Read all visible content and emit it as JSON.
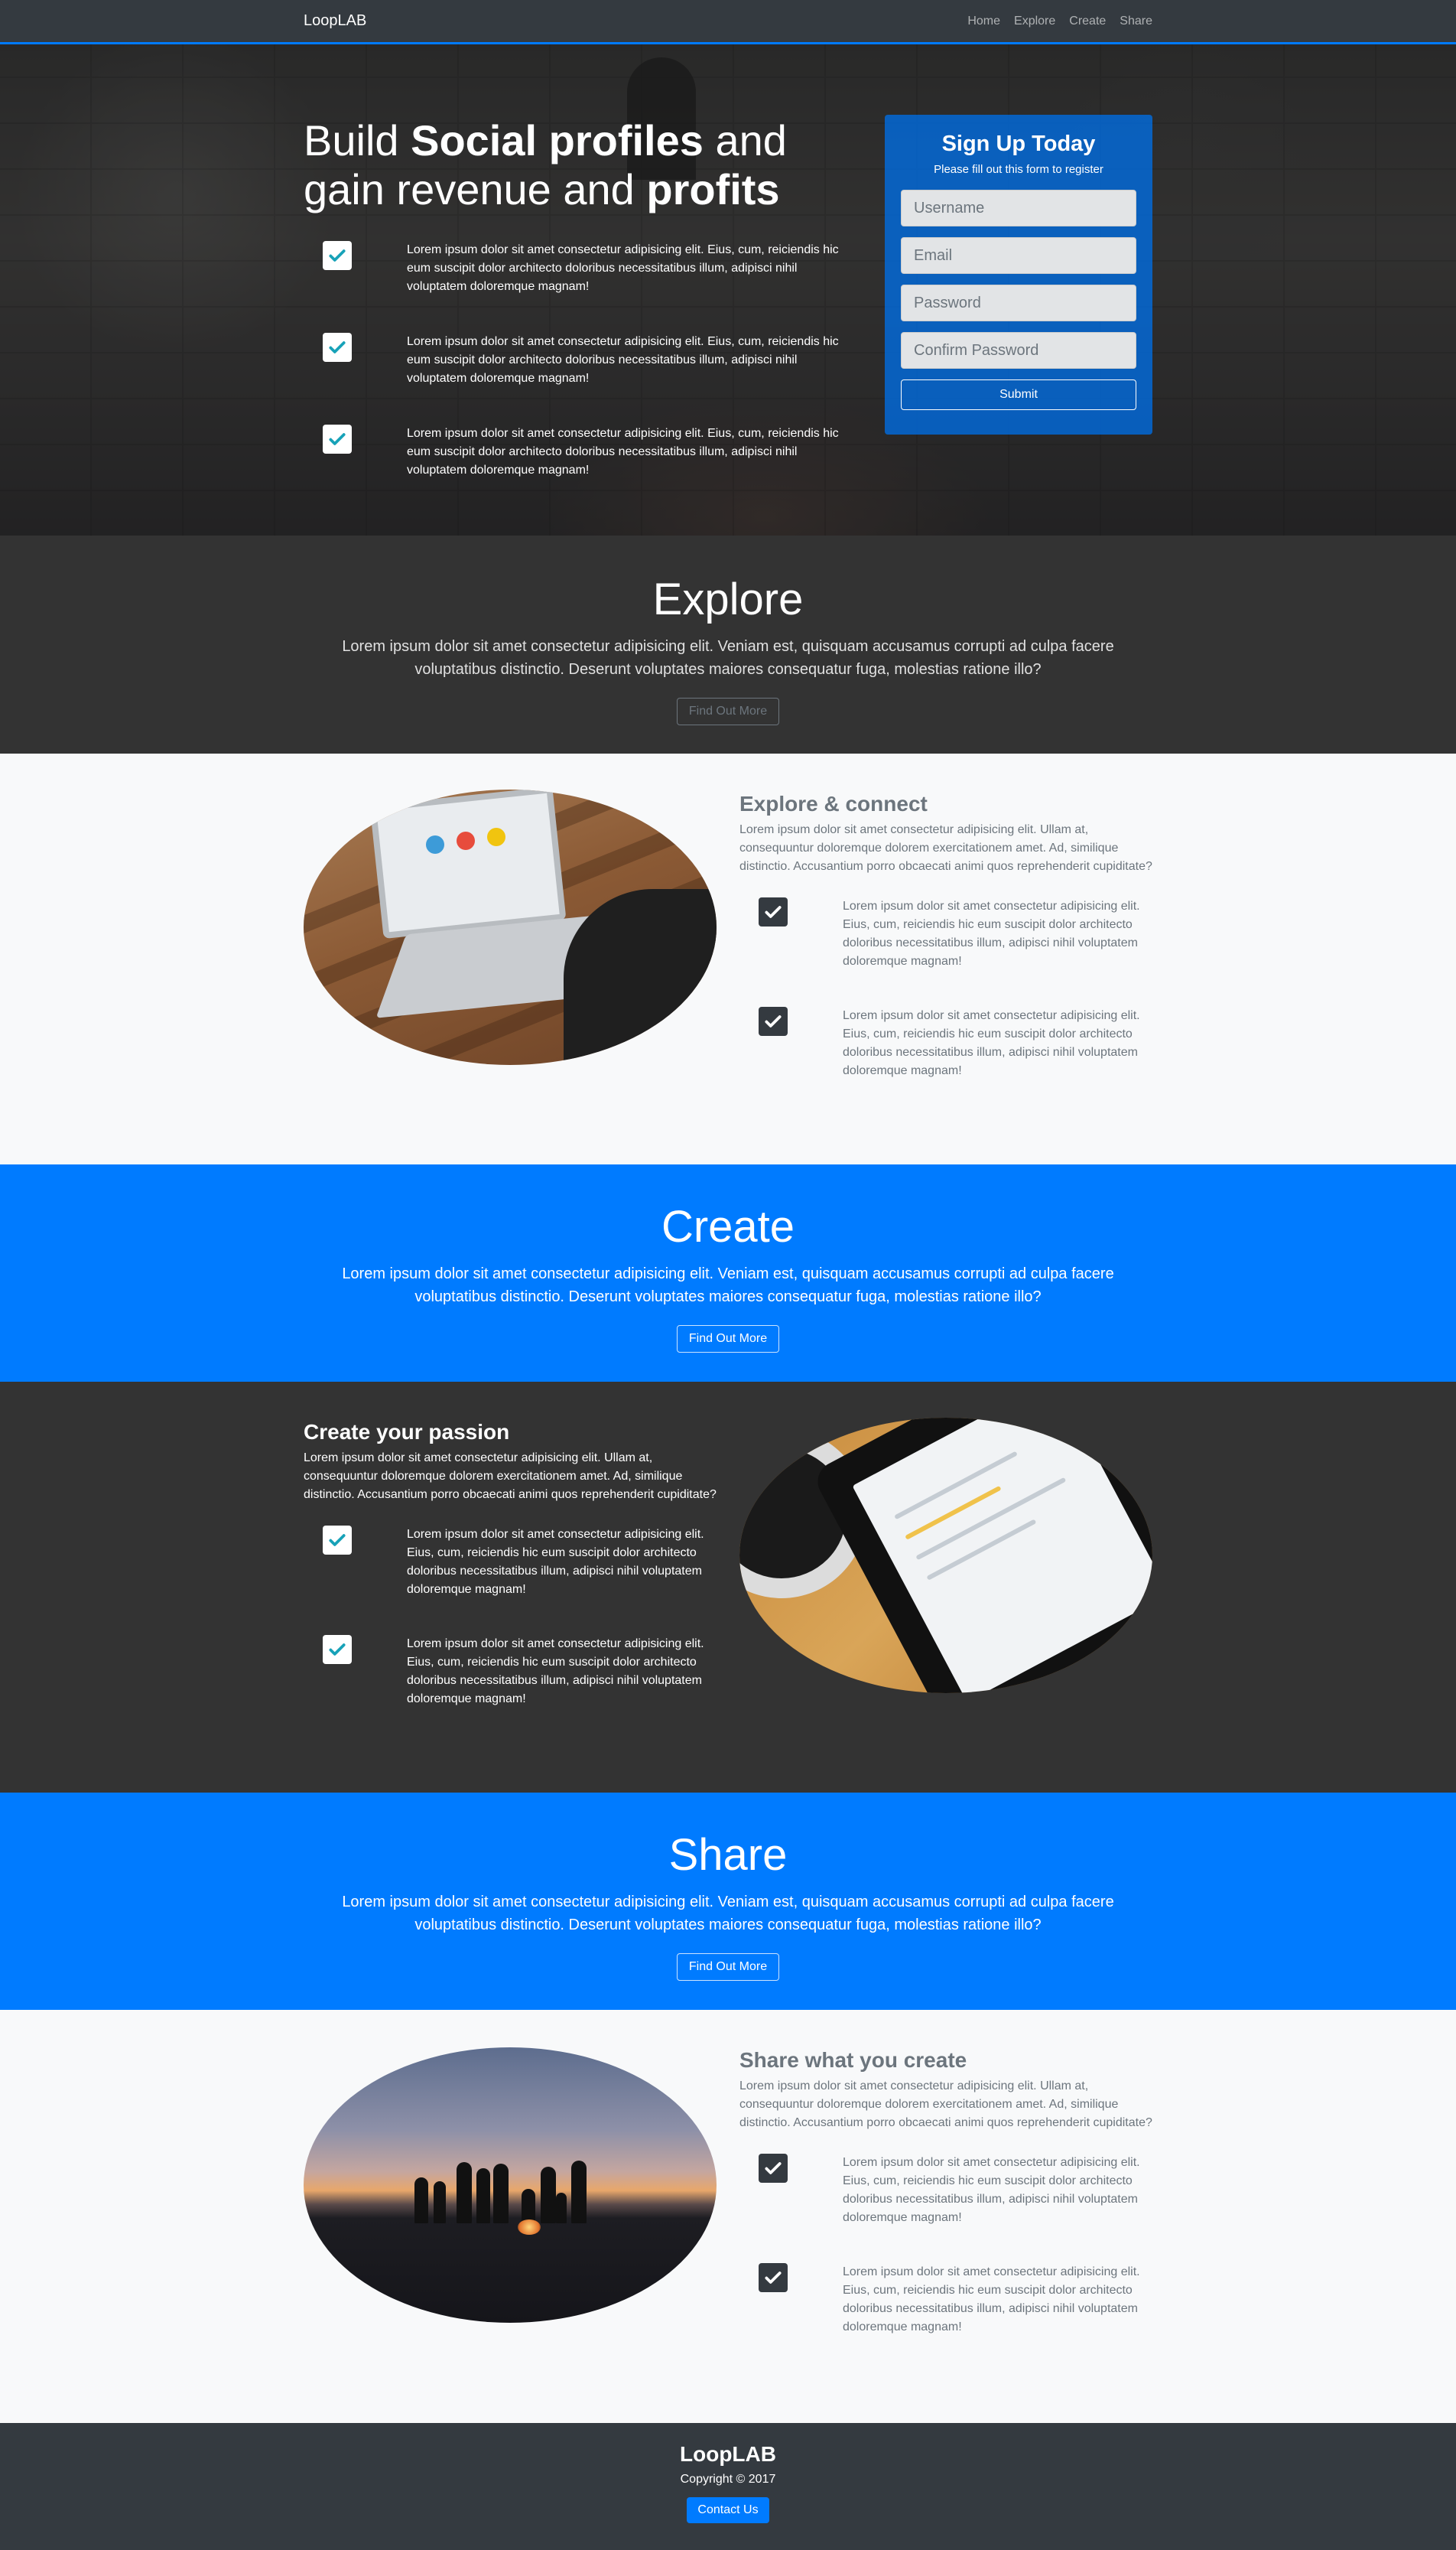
{
  "nav": {
    "brand": "LoopLAB",
    "links": [
      "Home",
      "Explore",
      "Create",
      "Share"
    ]
  },
  "hero": {
    "title_pre": "Build ",
    "title_bold1": "Social profiles",
    "title_mid": " and gain revenue and ",
    "title_bold2": "profits",
    "items": [
      "Lorem ipsum dolor sit amet consectetur adipisicing elit. Eius, cum, reiciendis hic eum suscipit dolor architecto doloribus necessitatibus illum, adipisci nihil voluptatem doloremque magnam!",
      "Lorem ipsum dolor sit amet consectetur adipisicing elit. Eius, cum, reiciendis hic eum suscipit dolor architecto doloribus necessitatibus illum, adipisci nihil voluptatem doloremque magnam!",
      "Lorem ipsum dolor sit amet consectetur adipisicing elit. Eius, cum, reiciendis hic eum suscipit dolor architecto doloribus necessitatibus illum, adipisci nihil voluptatem doloremque magnam!"
    ]
  },
  "signup": {
    "title": "Sign Up Today",
    "subtitle": "Please fill out this form to register",
    "username_placeholder": "Username",
    "email_placeholder": "Email",
    "password_placeholder": "Password",
    "confirm_placeholder": "Confirm Password",
    "submit_label": "Submit"
  },
  "explore": {
    "title": "Explore",
    "desc": "Lorem ipsum dolor sit amet consectetur adipisicing elit. Veniam est, quisquam accusamus corrupti ad culpa facere voluptatibus distinctio. Deserunt voluptates maiores consequatur fuga, molestias ratione illo?",
    "button": "Find Out More"
  },
  "explore_connect": {
    "title": "Explore & connect",
    "intro": "Lorem ipsum dolor sit amet consectetur adipisicing elit. Ullam at, consequuntur doloremque dolorem exercitationem amet. Ad, similique distinctio. Accusantium porro obcaecati animi quos reprehenderit cupiditate?",
    "items": [
      "Lorem ipsum dolor sit amet consectetur adipisicing elit. Eius, cum, reiciendis hic eum suscipit dolor architecto doloribus necessitatibus illum, adipisci nihil voluptatem doloremque magnam!",
      "Lorem ipsum dolor sit amet consectetur adipisicing elit. Eius, cum, reiciendis hic eum suscipit dolor architecto doloribus necessitatibus illum, adipisci nihil voluptatem doloremque magnam!"
    ]
  },
  "create": {
    "title": "Create",
    "desc": "Lorem ipsum dolor sit amet consectetur adipisicing elit. Veniam est, quisquam accusamus corrupti ad culpa facere voluptatibus distinctio. Deserunt voluptates maiores consequatur fuga, molestias ratione illo?",
    "button": "Find Out More"
  },
  "create_passion": {
    "title": "Create your passion",
    "intro": "Lorem ipsum dolor sit amet consectetur adipisicing elit. Ullam at, consequuntur doloremque dolorem exercitationem amet. Ad, similique distinctio. Accusantium porro obcaecati animi quos reprehenderit cupiditate?",
    "items": [
      "Lorem ipsum dolor sit amet consectetur adipisicing elit. Eius, cum, reiciendis hic eum suscipit dolor architecto doloribus necessitatibus illum, adipisci nihil voluptatem doloremque magnam!",
      "Lorem ipsum dolor sit amet consectetur adipisicing elit. Eius, cum, reiciendis hic eum suscipit dolor architecto doloribus necessitatibus illum, adipisci nihil voluptatem doloremque magnam!"
    ]
  },
  "share": {
    "title": "Share",
    "desc": "Lorem ipsum dolor sit amet consectetur adipisicing elit. Veniam est, quisquam accusamus corrupti ad culpa facere voluptatibus distinctio. Deserunt voluptates maiores consequatur fuga, molestias ratione illo?",
    "button": "Find Out More"
  },
  "share_create": {
    "title": "Share what you create",
    "intro": "Lorem ipsum dolor sit amet consectetur adipisicing elit. Ullam at, consequuntur doloremque dolorem exercitationem amet. Ad, similique distinctio. Accusantium porro obcaecati animi quos reprehenderit cupiditate?",
    "items": [
      "Lorem ipsum dolor sit amet consectetur adipisicing elit. Eius, cum, reiciendis hic eum suscipit dolor architecto doloribus necessitatibus illum, adipisci nihil voluptatem doloremque magnam!",
      "Lorem ipsum dolor sit amet consectetur adipisicing elit. Eius, cum, reiciendis hic eum suscipit dolor architecto doloribus necessitatibus illum, adipisci nihil voluptatem doloremque magnam!"
    ]
  },
  "footer": {
    "brand": "LoopLAB",
    "copyright": "Copyright © 2017",
    "contact": "Contact Us"
  },
  "colors": {
    "primary": "#007bff",
    "dark": "#343a40",
    "section_dark": "#333333",
    "light": "#f8f9fa",
    "muted": "#6c757d",
    "check_accent": "#17a2b8"
  },
  "icons": {
    "check": "check-square-icon"
  }
}
